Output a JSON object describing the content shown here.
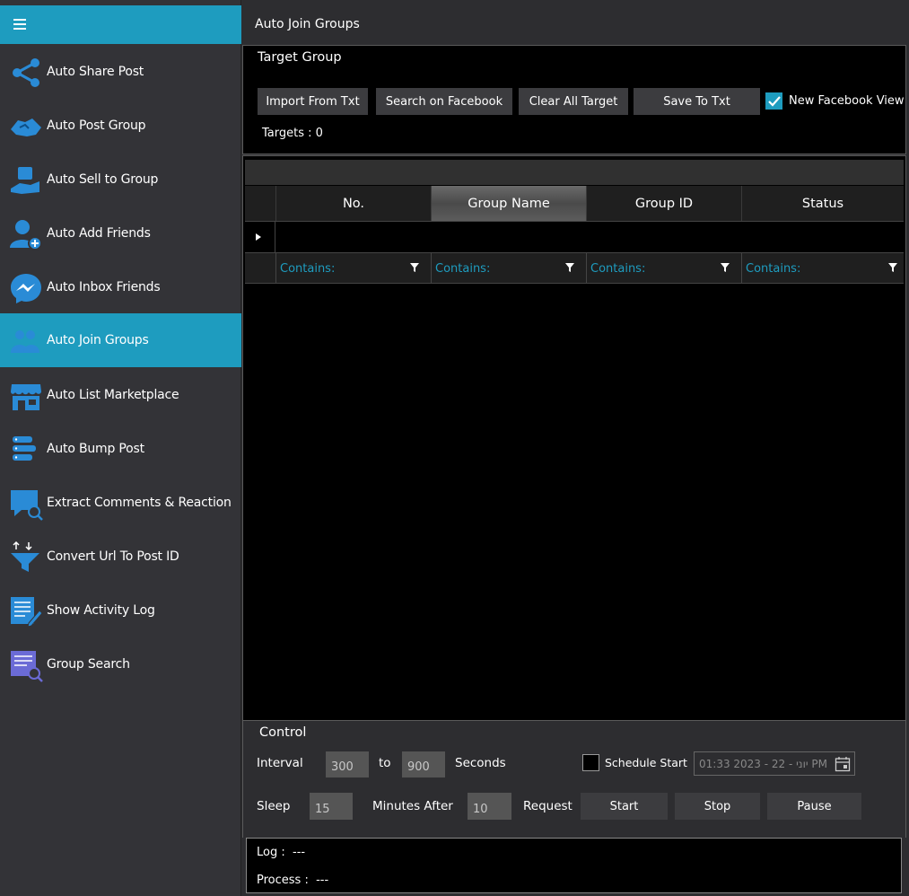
{
  "title": "Auto Join Groups",
  "sidebar": {
    "items": [
      {
        "label": "Auto Share Post",
        "icon": "share-icon"
      },
      {
        "label": "Auto Post Group",
        "icon": "handshake-icon"
      },
      {
        "label": "Auto Sell to Group",
        "icon": "sell-icon"
      },
      {
        "label": "Auto Add Friends",
        "icon": "add-friend-icon"
      },
      {
        "label": "Auto Inbox Friends",
        "icon": "messenger-icon"
      },
      {
        "label": "Auto Join Groups",
        "icon": "join-group-icon"
      },
      {
        "label": "Auto List Marketplace",
        "icon": "store-icon"
      },
      {
        "label": "Auto Bump Post",
        "icon": "bump-icon"
      },
      {
        "label": "Extract Comments & Reaction",
        "icon": "comment-search-icon"
      },
      {
        "label": "Convert Url To Post ID",
        "icon": "funnel-convert-icon"
      },
      {
        "label": "Show Activity Log",
        "icon": "activity-log-icon"
      },
      {
        "label": "Group Search",
        "icon": "group-search-icon"
      }
    ],
    "active_index": 5,
    "accent": "#1e9cbf"
  },
  "target_group": {
    "title": "Target Group",
    "import_label": "Import From Txt",
    "search_label": "Search on Facebook",
    "clear_label": "Clear All Target",
    "save_label": "Save To Txt",
    "new_view_label": "New Facebook View",
    "new_view_checked": true,
    "targets_text": "Targets : 0"
  },
  "grid": {
    "columns": [
      "No.",
      "Group Name",
      "Group ID",
      "Status"
    ],
    "selected_column": "Group Name",
    "filter_text": "Contains:"
  },
  "control": {
    "title": "Control",
    "interval_label": "Interval",
    "interval_from": "300",
    "to_label": "to",
    "interval_to": "900",
    "seconds_label": "Seconds",
    "schedule_label": "Schedule Start",
    "schedule_checked": false,
    "schedule_value": "01:33 2023 - 22 - יוני PM",
    "sleep_label": "Sleep",
    "sleep_value": "15",
    "minutes_after_label": "Minutes After",
    "request_value": "10",
    "request_label": "Request",
    "start_label": "Start",
    "stop_label": "Stop",
    "pause_label": "Pause"
  },
  "log": {
    "log_label": "Log :",
    "log_value": "---",
    "process_label": "Process :",
    "process_value": "---"
  }
}
